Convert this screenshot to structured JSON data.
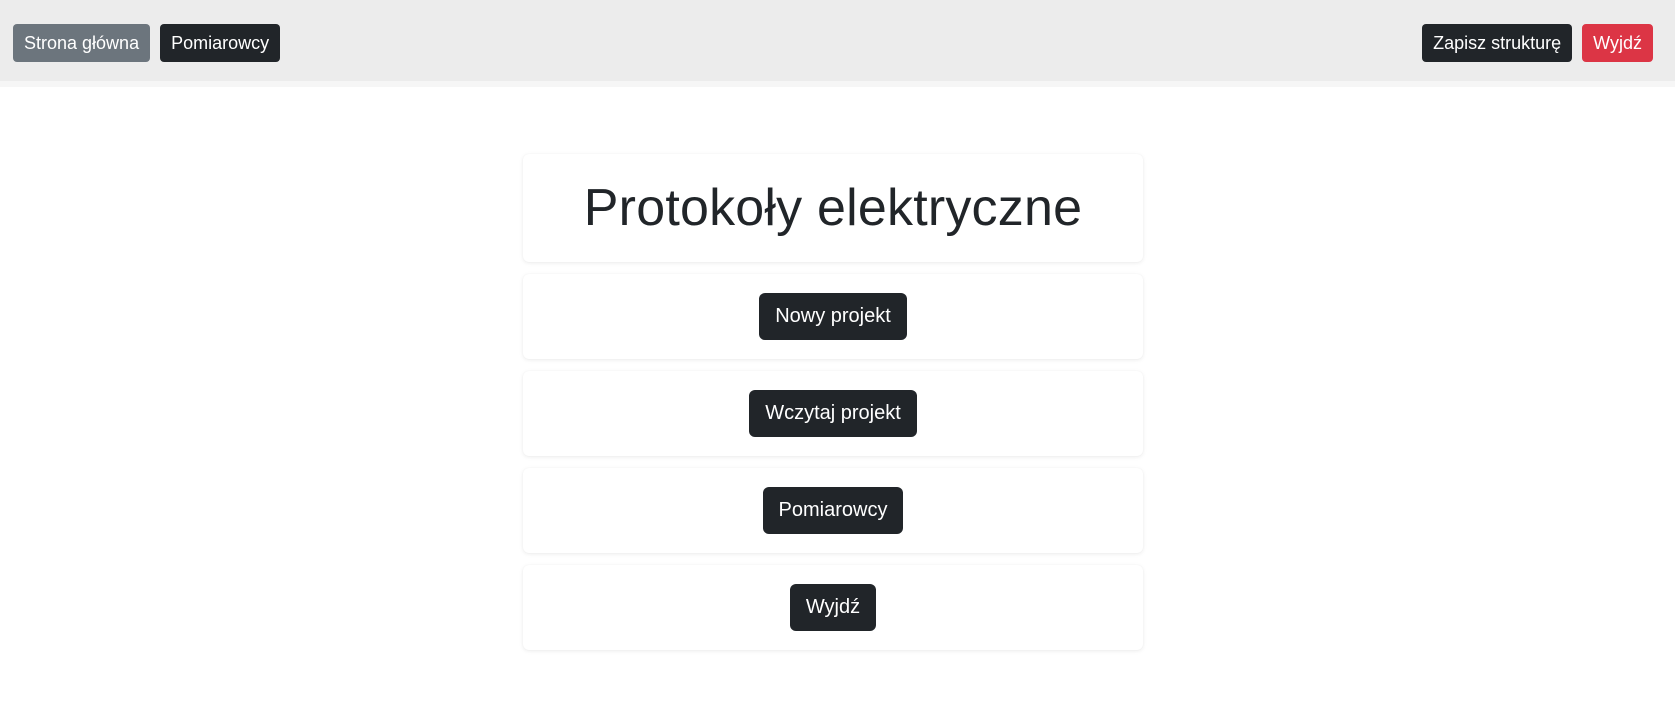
{
  "navbar": {
    "home_label": "Strona główna",
    "measurers_label": "Pomiarowcy",
    "save_structure_label": "Zapisz strukturę",
    "exit_label": "Wyjdź"
  },
  "main": {
    "title": "Protokoły elektryczne",
    "new_project_label": "Nowy projekt",
    "load_project_label": "Wczytaj projekt",
    "measurers_label": "Pomiarowcy",
    "exit_label": "Wyjdź"
  },
  "colors": {
    "topbar_bg": "#ececec",
    "secondary": "#6c757d",
    "dark": "#212529",
    "danger": "#dc3545"
  }
}
